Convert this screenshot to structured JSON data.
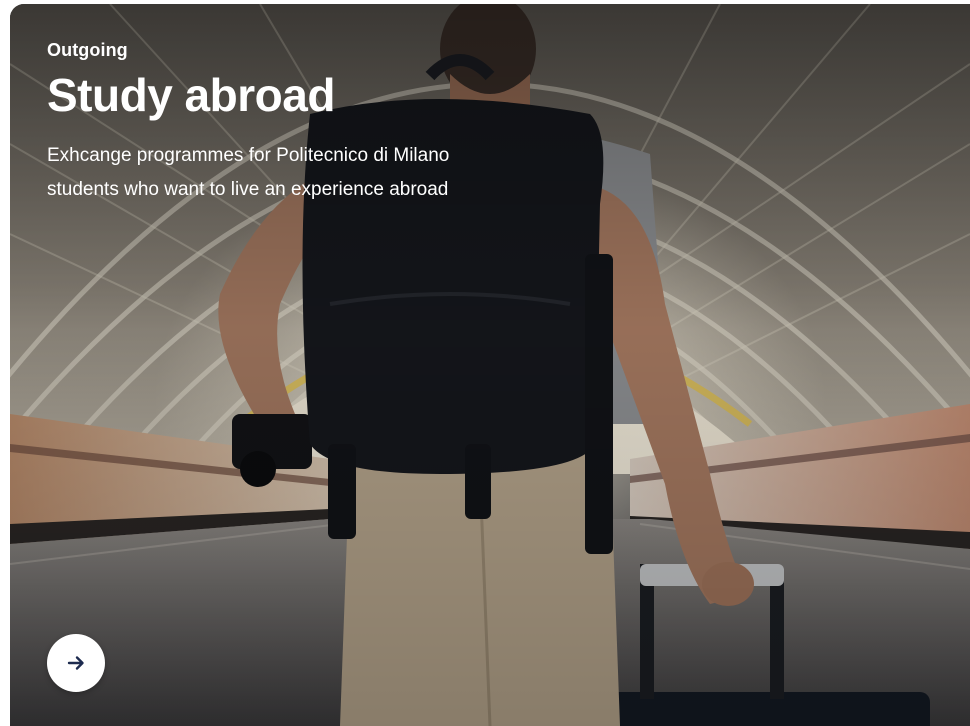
{
  "card": {
    "eyebrow": "Outgoing",
    "title": "Study abroad",
    "description": "Exhcange programmes for Politecnico di Milano students who want to live an experience abroad",
    "action_icon": "arrow-right-icon"
  },
  "colors": {
    "text": "#ffffff",
    "button_bg": "#ffffff",
    "arrow": "#1d2b4f"
  }
}
